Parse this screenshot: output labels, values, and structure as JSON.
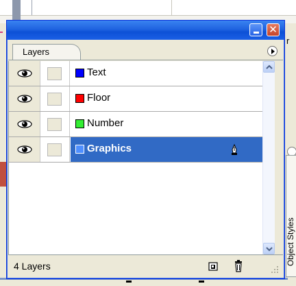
{
  "background": {
    "right_partial_text": "r",
    "side_panel_label": "Object Styles"
  },
  "palette": {
    "tab_label": "Layers",
    "titlebar": {
      "minimize_icon": "minimize-icon",
      "close_icon": "close-icon"
    },
    "layers": [
      {
        "name": "Text",
        "color": "#0000ff",
        "selected": false
      },
      {
        "name": "Floor",
        "color": "#ff0000",
        "selected": false
      },
      {
        "name": "Number",
        "color": "#33ee33",
        "selected": false
      },
      {
        "name": "Graphics",
        "color": "#4f8fff",
        "selected": true
      }
    ],
    "status": {
      "count_label": "4 Layers"
    }
  },
  "colors": {
    "selection": "#316ac5",
    "titlebar": "#1f63e0",
    "close_button": "#c5442a"
  }
}
